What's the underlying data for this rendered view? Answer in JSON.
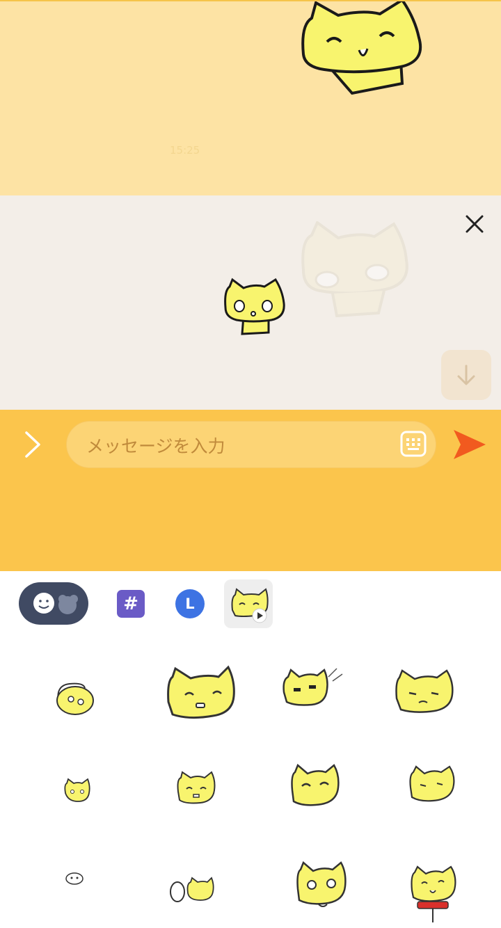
{
  "chat": {
    "timestamp": "15:25"
  },
  "composer": {
    "placeholder": "メッセージを入力"
  },
  "tabs": {
    "hash_label": "#",
    "line_label": "L"
  },
  "colors": {
    "chat_bg": "#fde3a4",
    "preview_bg": "#f3eee8",
    "input_bar_bg": "#fbc54c",
    "send_accent": "#f15a1f",
    "sticker_yellow": "#f8f46e",
    "tab_emoji_bg": "#404a63",
    "tab_hash_bg": "#6a5bc6",
    "tab_line_bg": "#3d73e3"
  },
  "icons": {
    "close": "close-icon",
    "scroll_down": "arrow-down-icon",
    "expand": "chevron-right-icon",
    "keyboard": "keyboard-icon",
    "send": "send-icon",
    "play_badge": "play-icon"
  },
  "sticker_grid": {
    "rows": 3,
    "columns": 4,
    "count": 12
  }
}
